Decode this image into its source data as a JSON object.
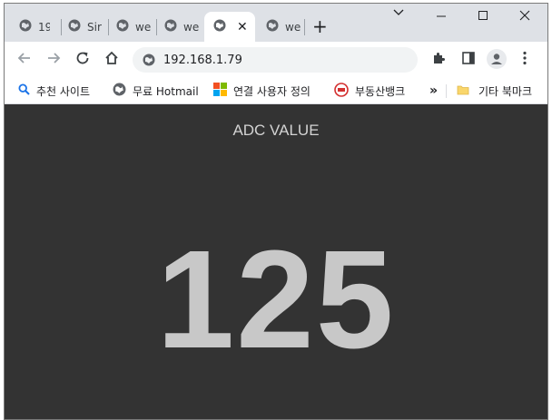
{
  "browser": {
    "tabs": [
      {
        "title": "19",
        "active": false
      },
      {
        "title": "Sir",
        "active": false
      },
      {
        "title": "we",
        "active": false
      },
      {
        "title": "we",
        "active": false
      },
      {
        "title": "",
        "active": true
      },
      {
        "title": "we",
        "active": false
      }
    ],
    "new_tab_label": "+",
    "window_controls": {
      "dropdown": "⌄",
      "minimize": "—",
      "maximize": "☐",
      "close": "✕"
    },
    "tab_close_glyph": "✕"
  },
  "toolbar": {
    "url": "192.168.1.79"
  },
  "bookmarks": {
    "items": [
      {
        "label": "추천 사이트",
        "icon": "search-icon"
      },
      {
        "label": "무료 Hotmail",
        "icon": "globe-icon"
      },
      {
        "label": "연결 사용자 정의",
        "icon": "windows-logo-icon"
      },
      {
        "label": "부동산뱅크",
        "icon": "realestate-logo-icon"
      }
    ],
    "overflow_label": "»",
    "other_folder_label": "기타 북마크"
  },
  "page": {
    "title": "ADC VALUE",
    "adc_value": "125"
  },
  "colors": {
    "page_background": "#333333",
    "value_color": "#c8c8c8",
    "title_color": "#d3d3d3",
    "tabstrip": "#dee1e6"
  }
}
